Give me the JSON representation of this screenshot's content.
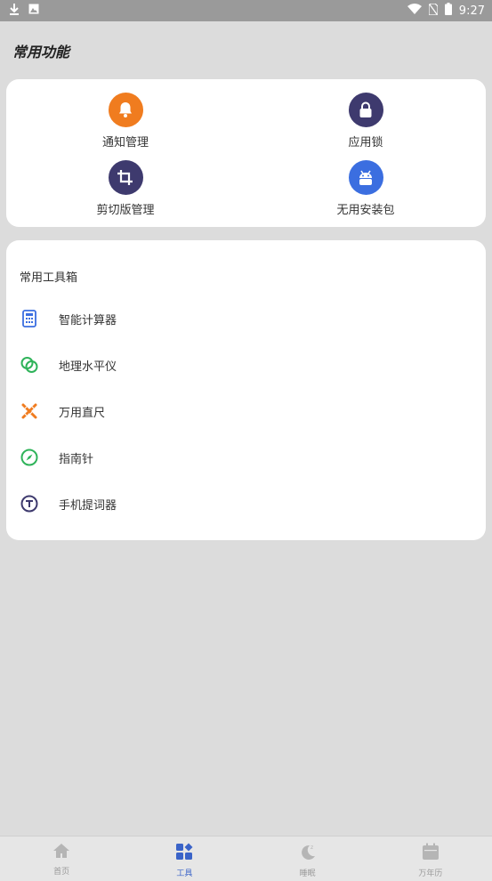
{
  "status_bar": {
    "time": "9:27"
  },
  "section_title": "常用功能",
  "functions": [
    {
      "label": "通知管理",
      "icon": "bell-icon",
      "color": "#f07c1f"
    },
    {
      "label": "应用锁",
      "icon": "lock-icon",
      "color": "#3e3a6e"
    },
    {
      "label": "剪切版管理",
      "icon": "crop-icon",
      "color": "#3e3a6e"
    },
    {
      "label": "无用安装包",
      "icon": "android-icon",
      "color": "#3b6ee0"
    }
  ],
  "toolbox": {
    "title": "常用工具箱",
    "items": [
      {
        "label": "智能计算器",
        "icon": "calculator-icon",
        "color": "#3b6ee0"
      },
      {
        "label": "地理水平仪",
        "icon": "level-icon",
        "color": "#2fb35a"
      },
      {
        "label": "万用直尺",
        "icon": "ruler-icon",
        "color": "#f07c1f"
      },
      {
        "label": "指南针",
        "icon": "compass-icon",
        "color": "#2fb35a"
      },
      {
        "label": "手机提词器",
        "icon": "teleprompter-icon",
        "color": "#3e3a6e"
      }
    ]
  },
  "bottom_nav": [
    {
      "label": "首页",
      "icon": "home-icon",
      "active": false
    },
    {
      "label": "工具",
      "icon": "tools-icon",
      "active": true
    },
    {
      "label": "睡眠",
      "icon": "moon-icon",
      "active": false
    },
    {
      "label": "万年历",
      "icon": "calendar-icon",
      "active": false
    }
  ]
}
